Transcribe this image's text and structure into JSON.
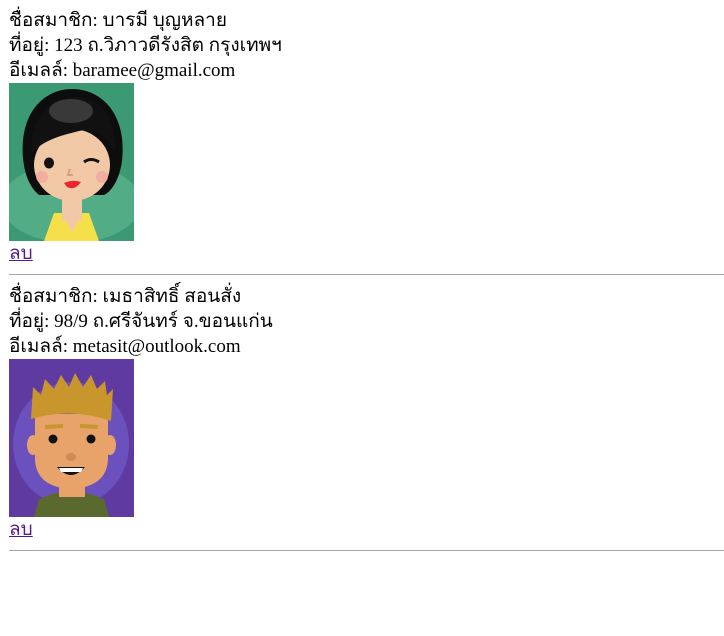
{
  "labels": {
    "name": "ชื่อสมาชิก: ",
    "address": "ที่อยู่: ",
    "email": "อีเมลล์: ",
    "delete": "ลบ"
  },
  "members": [
    {
      "name": "บารมี บุญหลาย",
      "address": "123 ถ.วิภาวดีรังสิต กรุงเทพฯ",
      "email": "baramee@gmail.com",
      "avatar_icon": "female-cartoon-avatar",
      "avatar_bg": "#3b9a73"
    },
    {
      "name": "เมธาสิทธิ์ สอนสั่ง",
      "address": "98/9 ถ.ศรีจันทร์ จ.ขอนแก่น",
      "email": "metasit@outlook.com",
      "avatar_icon": "male-cartoon-avatar",
      "avatar_bg": "#5f3aa0"
    }
  ]
}
